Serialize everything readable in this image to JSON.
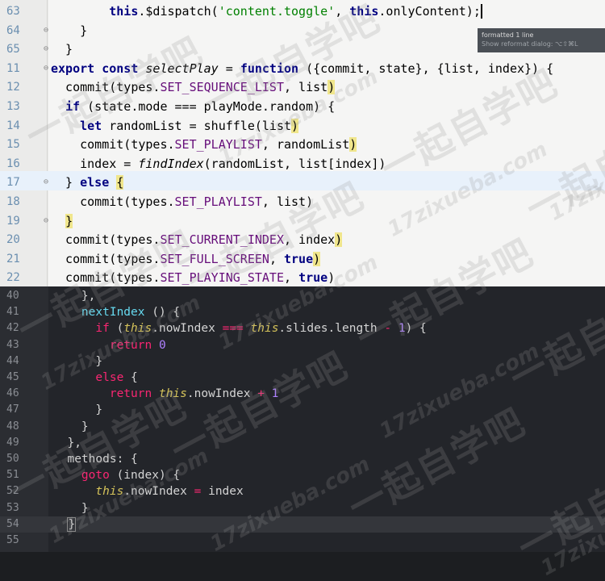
{
  "top_editor": {
    "lines": [
      {
        "ln": "63",
        "html": "        <span class=\"tk-kw\">this</span>.$dispatch(<span class=\"tk-str\">'content.toggle'</span>, <span class=\"tk-kw\">this</span>.onlyContent)<span class=\"tk-caret\">;</span>"
      },
      {
        "ln": "64",
        "html": "    }"
      },
      {
        "ln": "65",
        "html": "  }"
      },
      {
        "ln": "11",
        "html": "<span class=\"tk-kw\">export const</span> <span class=\"tk-fn-it\">selectPlay</span> = <span class=\"tk-kw\">function</span> ({commit, state}, {list, index}) {"
      },
      {
        "ln": "12",
        "html": "  commit(types.<span class=\"tk-prop\">SET_SEQUENCE_LIST</span>, list<span class=\"tk-brk\">)</span>"
      },
      {
        "ln": "13",
        "html": "  <span class=\"tk-kw\">if</span> (state.mode === playMode.random) {"
      },
      {
        "ln": "14",
        "html": "    <span class=\"tk-kw\">let</span> randomList = shuffle(list<span class=\"tk-brk\">)</span>"
      },
      {
        "ln": "15",
        "html": "    commit(types.<span class=\"tk-prop\">SET_PLAYLIST</span>, randomList<span class=\"tk-brk\">)</span>"
      },
      {
        "ln": "16",
        "html": "    index = <span class=\"tk-fn-it\">findIndex</span>(randomList, list[index])"
      },
      {
        "ln": "17",
        "html": "  } <span class=\"tk-kw\">else</span> <span class=\"tk-brk\">{</span>"
      },
      {
        "ln": "18",
        "html": "    commit(types.<span class=\"tk-prop\">SET_PLAYLIST</span>, list)"
      },
      {
        "ln": "19",
        "html": "  <span class=\"tk-brk\">}</span>"
      },
      {
        "ln": "20",
        "html": "  commit(types.<span class=\"tk-prop\">SET_CURRENT_INDEX</span>, index<span class=\"tk-brk\">)</span>"
      },
      {
        "ln": "21",
        "html": "  commit(types.<span class=\"tk-prop\">SET_FULL_SCREEN</span>, <span class=\"tk-kw\">true</span><span class=\"tk-brk\">)</span>"
      },
      {
        "ln": "22",
        "html": "  commit(types.<span class=\"tk-prop\">SET_PLAYING_STATE</span>, <span class=\"tk-kw\">true</span>)"
      }
    ],
    "tooltip_title": "formatted 1 line",
    "tooltip_sub": "Show reformat dialog: ⌥⇧⌘L"
  },
  "bottom_editor": {
    "lines": [
      {
        "ln": "40",
        "html": "    },"
      },
      {
        "ln": "41",
        "html": "    <span class=\"k-fn\">nextIndex</span> () {"
      },
      {
        "ln": "42",
        "html": "      <span class=\"k-kw\">if</span> (<span class=\"k-this\">this</span>.nowIndex <span class=\"k-op\">===</span> <span class=\"k-this\">this</span>.slides.length <span class=\"k-op\">-</span> <span class=\"k-num\">1</span>) {"
      },
      {
        "ln": "43",
        "html": "        <span class=\"k-kw\">return</span> <span class=\"k-num\">0</span>"
      },
      {
        "ln": "44",
        "html": "      }"
      },
      {
        "ln": "45",
        "html": "      <span class=\"k-kw\">else</span> {"
      },
      {
        "ln": "46",
        "html": "        <span class=\"k-kw\">return</span> <span class=\"k-this\">this</span>.nowIndex <span class=\"k-op\">+</span> <span class=\"k-num\">1</span>"
      },
      {
        "ln": "47",
        "html": "      }"
      },
      {
        "ln": "48",
        "html": "    }"
      },
      {
        "ln": "49",
        "html": "  },"
      },
      {
        "ln": "50",
        "html": "  methods: {"
      },
      {
        "ln": "51",
        "html": "    <span class=\"k-kw\">goto</span> (index) {"
      },
      {
        "ln": "52",
        "html": "      <span class=\"k-this\">this</span>.nowIndex <span class=\"k-op\">=</span> index"
      },
      {
        "ln": "53",
        "html": "    }"
      },
      {
        "ln": "54",
        "html": "  <span class=\"k-brk-hl\">}</span>"
      },
      {
        "ln": "55",
        "html": ""
      }
    ]
  },
  "watermark": {
    "cn": "一起自学吧",
    "en": "17zixueba.com"
  }
}
